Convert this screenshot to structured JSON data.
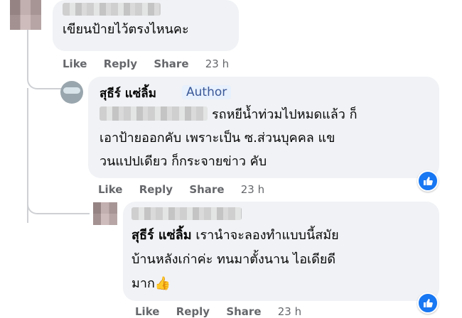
{
  "comments": [
    {
      "text": "เขียนป้ายไว้ตรงไหนคะ",
      "actions": {
        "like": "Like",
        "reply": "Reply",
        "share": "Share",
        "time": "23 h"
      }
    },
    {
      "name": "สุธีร์ แซ่ลิ้ม",
      "badge": "Author",
      "lines": [
        "รถหยีน้ำท่วมไปหมดแล้ว ก็",
        "เอาป้ายออกคับ เพราะเป็น ซ.ส่วนบุคคล แข",
        "วนแปปเดียว ก็กระจายข่าว คับ"
      ],
      "reaction": "like",
      "actions": {
        "like": "Like",
        "reply": "Reply",
        "share": "Share",
        "time": "23 h"
      }
    },
    {
      "mention": "สุธีร์ แซ่ลิ้ม",
      "lines": [
        " เรานำจะลองทำแบบนี้สมัย",
        "บ้านหลังเก่าค่ะ ทนมาตั้งนาน ไอเดียดี",
        "มาก👍"
      ],
      "reaction": "like",
      "actions": {
        "like": "Like",
        "reply": "Reply",
        "share": "Share",
        "time": "23 h"
      }
    }
  ]
}
